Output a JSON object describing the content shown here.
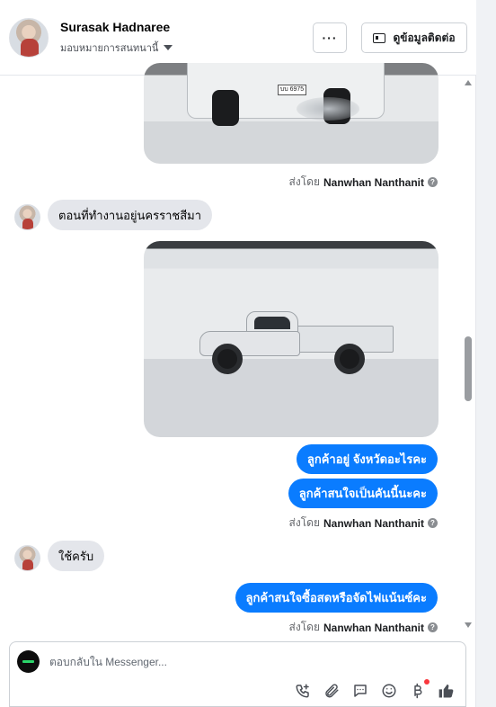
{
  "header": {
    "user_name": "Surasak Hadnaree",
    "assign_label": "มอบหมายการสนทนานี้",
    "more_label": "···",
    "contact_button_label": "ดูข้อมูลติดต่อ"
  },
  "messages": {
    "sent_by_prefix": "ส่งโดย",
    "sent_by_name": "Nanwhan Nanthanit",
    "help_glyph": "?",
    "photo1_plate": "บบ 6975",
    "incoming1": "ตอนที่ทำงานอยู่นครราชสีมา",
    "outgoing1": "ลูกค้าอยู่ จังหวัดอะไรคะ",
    "outgoing2": "ลูกค้าสนใจเป็นคันนี้นะคะ",
    "incoming2": "ใช้ครับ",
    "outgoing3": "ลูกค้าสนใจซื้อสดหรือจัดไฟแน้นซ์คะ"
  },
  "composer": {
    "placeholder": "ตอบกลับใน Messenger...",
    "tools": [
      "phone-plus-icon",
      "paperclip-icon",
      "chat-bubble-icon",
      "smiley-icon",
      "baht-icon",
      "thumbs-up-icon"
    ]
  },
  "colors": {
    "accent_blue": "#0a7cff",
    "incoming_bubble": "#e4e6eb",
    "notification_red": "#fa383e"
  }
}
